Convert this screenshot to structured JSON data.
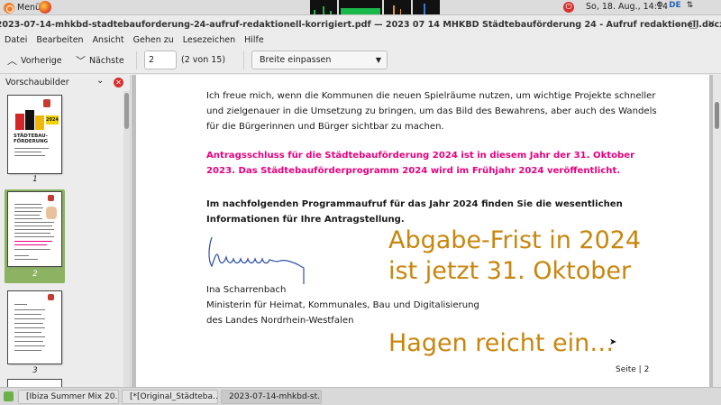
{
  "top_panel": {
    "menu_label": "Menü",
    "clock": "So, 18. Aug., 14:14",
    "language": "DE"
  },
  "window": {
    "title": "2023-07-14-mhkbd-stadtebauforderung-24-aufruf-redaktionell-korrigiert.pdf — 2023 07 14 MHKBD Städtebauförderung 24 - Aufruf redaktionell.docx"
  },
  "menubar": [
    "Datei",
    "Bearbeiten",
    "Ansicht",
    "Gehen zu",
    "Lesezeichen",
    "Hilfe"
  ],
  "toolbar": {
    "prev_label": "Vorherige",
    "next_label": "Nächste",
    "page_value": "2",
    "page_count": "(2 von 15)",
    "zoom_value": "Breite einpassen"
  },
  "sidebar": {
    "title": "Vorschaubilder",
    "thumbs": [
      {
        "label": "1",
        "cover_title": "STÄDTEBAU-\nFÖRDERUNG",
        "badge": "2024"
      },
      {
        "label": "2"
      },
      {
        "label": "3"
      }
    ]
  },
  "document": {
    "intro": "Ich freue mich, wenn die Kommunen die neuen Spielräume nutzen, um wichtige Projekte schneller und zielgenauer in die Umsetzung zu bringen, um das Bild des Bewahrens, aber auch des Wandels für die Bürgerinnen und Bürger sichtbar zu machen.",
    "deadline": "Antragsschluss für die Städtebauförderung 2024 ist in diesem Jahr der 31. Oktober 2023. Das Städtebauförderprogramm 2024 wird im Frühjahr 2024 veröffentlicht.",
    "call": "Im nachfolgenden Programmaufruf für das Jahr 2024 finden Sie die wesentlichen Informationen für Ihre Antragstellung.",
    "signer_name": "Ina Scharrenbach",
    "signer_title": "Ministerin für Heimat, Kommunales, Bau und Digitalisierung",
    "signer_state": "des Landes Nordrhein-Westfalen",
    "annotation_1_line1": "Abgabe-Frist in 2024",
    "annotation_1_line2": "ist jetzt 31. Oktober",
    "annotation_2": "Hagen reicht ein…",
    "footer": "Seite | 2",
    "colors": {
      "deadline": "#e6007e",
      "annotation": "#c8860f"
    }
  },
  "taskbar": {
    "tasks": [
      "[Ibiza Summer Mix 20…",
      "[*[Original_Städtebа…",
      "2023-07-14-mhkbd-st…"
    ]
  }
}
